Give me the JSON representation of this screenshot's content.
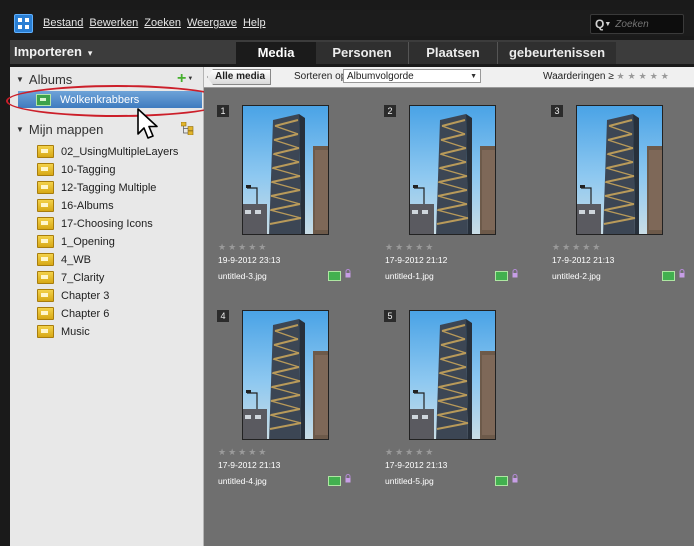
{
  "menubar": {
    "items": [
      "Bestand",
      "Bewerken",
      "Zoeken",
      "Weergave",
      "Help"
    ],
    "search_placeholder": "Zoeken"
  },
  "tabbar": {
    "importeren": "Importeren",
    "tabs": [
      "Media",
      "Personen",
      "Plaatsen",
      "gebeurtenissen"
    ],
    "active_tab": "Media"
  },
  "sidebar": {
    "albums_header": "Albums",
    "album": "Wolkenkrabbers",
    "folders_header": "Mijn mappen",
    "folders": [
      "02_UsingMultipleLayers",
      "10-Tagging",
      "12-Tagging Multiple",
      "16-Albums",
      "17-Choosing Icons",
      "1_Opening",
      "4_WB",
      "7_Clarity",
      "Chapter 3",
      "Chapter 6",
      "Music"
    ]
  },
  "toolbar": {
    "all_media": "Alle media",
    "sort_label": "Sorteren op:",
    "sort_value": "Albumvolgorde",
    "ratings_label": "Waarderingen",
    "ratings_op": "≥",
    "ratings_stars": "★★★★★"
  },
  "media": [
    {
      "num": "1",
      "stars": "★★★★★",
      "date": "19-9-2012 23:13",
      "file": "untitled-3.jpg"
    },
    {
      "num": "2",
      "stars": "★★★★★",
      "date": "17-9-2012 21:12",
      "file": "untitled-1.jpg"
    },
    {
      "num": "3",
      "stars": "★★★★★",
      "date": "17-9-2012 21:13",
      "file": "untitled-2.jpg"
    },
    {
      "num": "4",
      "stars": "★★★★★",
      "date": "17-9-2012 21:13",
      "file": "untitled-4.jpg"
    },
    {
      "num": "5",
      "stars": "★★★★★",
      "date": "17-9-2012 21:13",
      "file": "untitled-5.jpg"
    }
  ],
  "colors": {
    "selection": "#4a86c8",
    "highlight_circle": "#cc1f2a",
    "tag_green": "#42b04f"
  }
}
